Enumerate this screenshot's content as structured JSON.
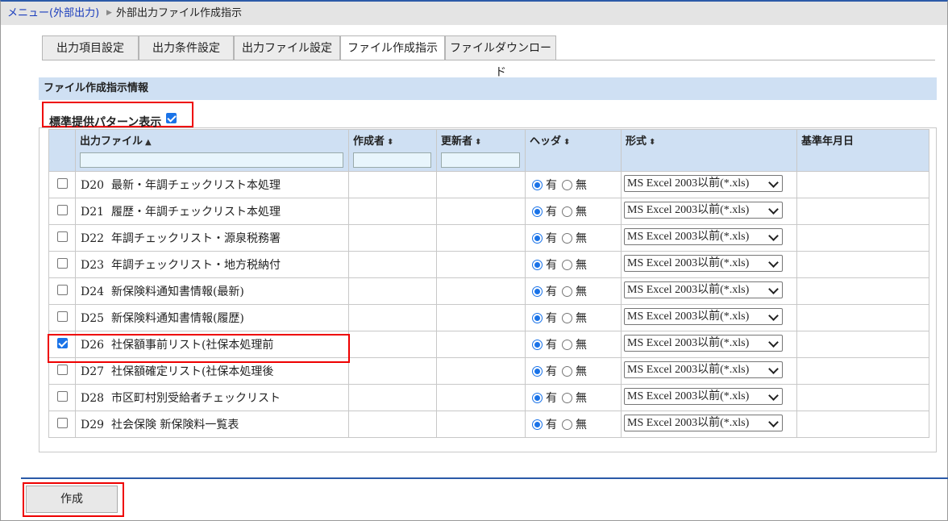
{
  "breadcrumb": {
    "link": "メニュー(外部出力)",
    "separator": "▶",
    "current": "外部出力ファイル作成指示"
  },
  "tabs": [
    {
      "label": "出力項目設定",
      "active": false
    },
    {
      "label": "出力条件設定",
      "active": false
    },
    {
      "label": "出力ファイル設定",
      "active": false
    },
    {
      "label": "ファイル作成指示",
      "active": true
    },
    {
      "label": "ファイルダウンロード",
      "active": false
    }
  ],
  "section": {
    "title": "ファイル作成指示情報",
    "pattern_label": "標準提供パターン表示",
    "pattern_checked": true
  },
  "table": {
    "headers": {
      "file": "出力ファイル",
      "creator": "作成者",
      "updater": "更新者",
      "header": "ヘッダ",
      "format": "形式",
      "base_date": "基準年月日"
    },
    "sort_asc": "▲",
    "sort_both": "⬍",
    "radio_yes": "有",
    "radio_no": "無",
    "rows": [
      {
        "code": "D20",
        "name": "最新・年調チェックリスト本処理",
        "checked": false,
        "header_yes": true,
        "format": "MS Excel 2003以前(*.xls)"
      },
      {
        "code": "D21",
        "name": "履歴・年調チェックリスト本処理",
        "checked": false,
        "header_yes": true,
        "format": "MS Excel 2003以前(*.xls)"
      },
      {
        "code": "D22",
        "name": "年調チェックリスト・源泉税務署",
        "checked": false,
        "header_yes": true,
        "format": "MS Excel 2003以前(*.xls)"
      },
      {
        "code": "D23",
        "name": "年調チェックリスト・地方税納付",
        "checked": false,
        "header_yes": true,
        "format": "MS Excel 2003以前(*.xls)"
      },
      {
        "code": "D24",
        "name": "新保険料通知書情報(最新)",
        "checked": false,
        "header_yes": true,
        "format": "MS Excel 2003以前(*.xls)"
      },
      {
        "code": "D25",
        "name": "新保険料通知書情報(履歴)",
        "checked": false,
        "header_yes": true,
        "format": "MS Excel 2003以前(*.xls)"
      },
      {
        "code": "D26",
        "name": "社保額事前リスト(社保本処理前",
        "checked": true,
        "header_yes": true,
        "format": "MS Excel 2003以前(*.xls)"
      },
      {
        "code": "D27",
        "name": "社保額確定リスト(社保本処理後",
        "checked": false,
        "header_yes": true,
        "format": "MS Excel 2003以前(*.xls)"
      },
      {
        "code": "D28",
        "name": "市区町村別受給者チェックリスト",
        "checked": false,
        "header_yes": true,
        "format": "MS Excel 2003以前(*.xls)"
      },
      {
        "code": "D29",
        "name": "社会保険 新保険料一覧表",
        "checked": false,
        "header_yes": true,
        "format": "MS Excel 2003以前(*.xls)"
      }
    ]
  },
  "footer": {
    "create_label": "作成"
  },
  "colors": {
    "accent_blue": "#2b5aa8",
    "link": "#1a3dbd",
    "header_bg": "#cfe0f3",
    "highlight": "#e00000",
    "check_blue": "#1a73e8"
  }
}
